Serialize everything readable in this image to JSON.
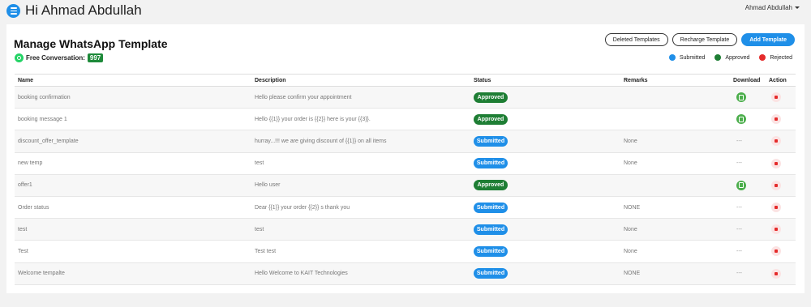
{
  "header": {
    "greeting": "Hi Ahmad Abdullah",
    "user_name": "Ahmad Abdullah"
  },
  "page": {
    "title": "Manage WhatsApp Template",
    "free_conversation_label": "Free Conversation:",
    "free_conversation_count": "997"
  },
  "buttons": {
    "deleted_templates": "Deleted Templates",
    "recharge_template": "Recharge Template",
    "add_template": "Add Template"
  },
  "legend": [
    {
      "label": "Submitted",
      "color": "#1f8fe8"
    },
    {
      "label": "Approved",
      "color": "#1e7e34"
    },
    {
      "label": "Rejected",
      "color": "#e52b2b"
    }
  ],
  "colors": {
    "approved": "#1e7e34",
    "submitted": "#1f8fe8",
    "rejected": "#e52b2b",
    "download": "#4cae4c"
  },
  "table": {
    "headers": {
      "name": "Name",
      "description": "Description",
      "status": "Status",
      "remarks": "Remarks",
      "download": "Download",
      "action": "Action"
    },
    "rows": [
      {
        "name": "booking confirmation",
        "description": "Hello please confirm your appointment",
        "status": "Approved",
        "remarks": "",
        "download": "download-icon"
      },
      {
        "name": "booking message 1",
        "description": "Hello {{1}} your order is {{2}} here is your {{3}}.",
        "status": "Approved",
        "remarks": "",
        "download": "download-icon"
      },
      {
        "name": "discount_offer_template",
        "description": "hurray...!!! we are giving discount of {{1}} on all items",
        "status": "Submitted",
        "remarks": "None",
        "download": "---"
      },
      {
        "name": "new temp",
        "description": "test",
        "status": "Submitted",
        "remarks": "None",
        "download": "---"
      },
      {
        "name": "offer1",
        "description": "Hello user",
        "status": "Approved",
        "remarks": "",
        "download": "download-icon"
      },
      {
        "name": "Order status",
        "description": "Dear {{1}} your order {{2}} s thank you",
        "status": "Submitted",
        "remarks": "NONE",
        "download": "---"
      },
      {
        "name": "test",
        "description": "test",
        "status": "Submitted",
        "remarks": "None",
        "download": "---"
      },
      {
        "name": "Test",
        "description": "Test test",
        "status": "Submitted",
        "remarks": "None",
        "download": "---"
      },
      {
        "name": "Welcome tempalte",
        "description": "Hello Welcome to KAIT Technologies",
        "status": "Submitted",
        "remarks": "NONE",
        "download": "---"
      }
    ]
  }
}
